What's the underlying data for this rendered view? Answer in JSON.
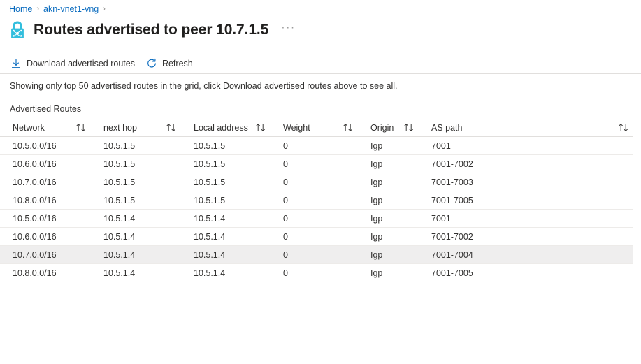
{
  "breadcrumb": {
    "items": [
      {
        "label": "Home",
        "icon": "none"
      },
      {
        "label": "akn-vnet1-vng",
        "icon": "none"
      }
    ],
    "separator": "›"
  },
  "header": {
    "icon": "vpn-gateway-lock-icon",
    "title": "Routes advertised to peer 10.7.1.5",
    "more_label": "···"
  },
  "commandbar": {
    "download_label": "Download advertised routes",
    "download_icon": "download-icon",
    "refresh_label": "Refresh",
    "refresh_icon": "refresh-icon"
  },
  "notice": "Showing only top 50 advertised routes in the grid, click Download advertised routes above to see all.",
  "section_label": "Advertised Routes",
  "grid": {
    "sort_icon": "sort-updown-icon",
    "columns": [
      {
        "key": "network",
        "label": "Network"
      },
      {
        "key": "next_hop",
        "label": "next hop"
      },
      {
        "key": "local_address",
        "label": "Local address"
      },
      {
        "key": "weight",
        "label": "Weight"
      },
      {
        "key": "origin",
        "label": "Origin"
      },
      {
        "key": "as_path",
        "label": "AS path"
      }
    ],
    "rows": [
      {
        "network": "10.5.0.0/16",
        "next_hop": "10.5.1.5",
        "local_address": "10.5.1.5",
        "weight": "0",
        "origin": "Igp",
        "as_path": "7001",
        "selected": false
      },
      {
        "network": "10.6.0.0/16",
        "next_hop": "10.5.1.5",
        "local_address": "10.5.1.5",
        "weight": "0",
        "origin": "Igp",
        "as_path": "7001-7002",
        "selected": false
      },
      {
        "network": "10.7.0.0/16",
        "next_hop": "10.5.1.5",
        "local_address": "10.5.1.5",
        "weight": "0",
        "origin": "Igp",
        "as_path": "7001-7003",
        "selected": false
      },
      {
        "network": "10.8.0.0/16",
        "next_hop": "10.5.1.5",
        "local_address": "10.5.1.5",
        "weight": "0",
        "origin": "Igp",
        "as_path": "7001-7005",
        "selected": false
      },
      {
        "network": "10.5.0.0/16",
        "next_hop": "10.5.1.4",
        "local_address": "10.5.1.4",
        "weight": "0",
        "origin": "Igp",
        "as_path": "7001",
        "selected": false
      },
      {
        "network": "10.6.0.0/16",
        "next_hop": "10.5.1.4",
        "local_address": "10.5.1.4",
        "weight": "0",
        "origin": "Igp",
        "as_path": "7001-7002",
        "selected": false
      },
      {
        "network": "10.7.0.0/16",
        "next_hop": "10.5.1.4",
        "local_address": "10.5.1.4",
        "weight": "0",
        "origin": "Igp",
        "as_path": "7001-7004",
        "selected": true
      },
      {
        "network": "10.8.0.0/16",
        "next_hop": "10.5.1.4",
        "local_address": "10.5.1.4",
        "weight": "0",
        "origin": "Igp",
        "as_path": "7001-7005",
        "selected": false
      }
    ]
  },
  "colors": {
    "link": "#0b6cbf",
    "icon_accent": "#32bedd",
    "text": "#323130",
    "row_selected": "#efeeee",
    "divider": "#edebe9"
  }
}
